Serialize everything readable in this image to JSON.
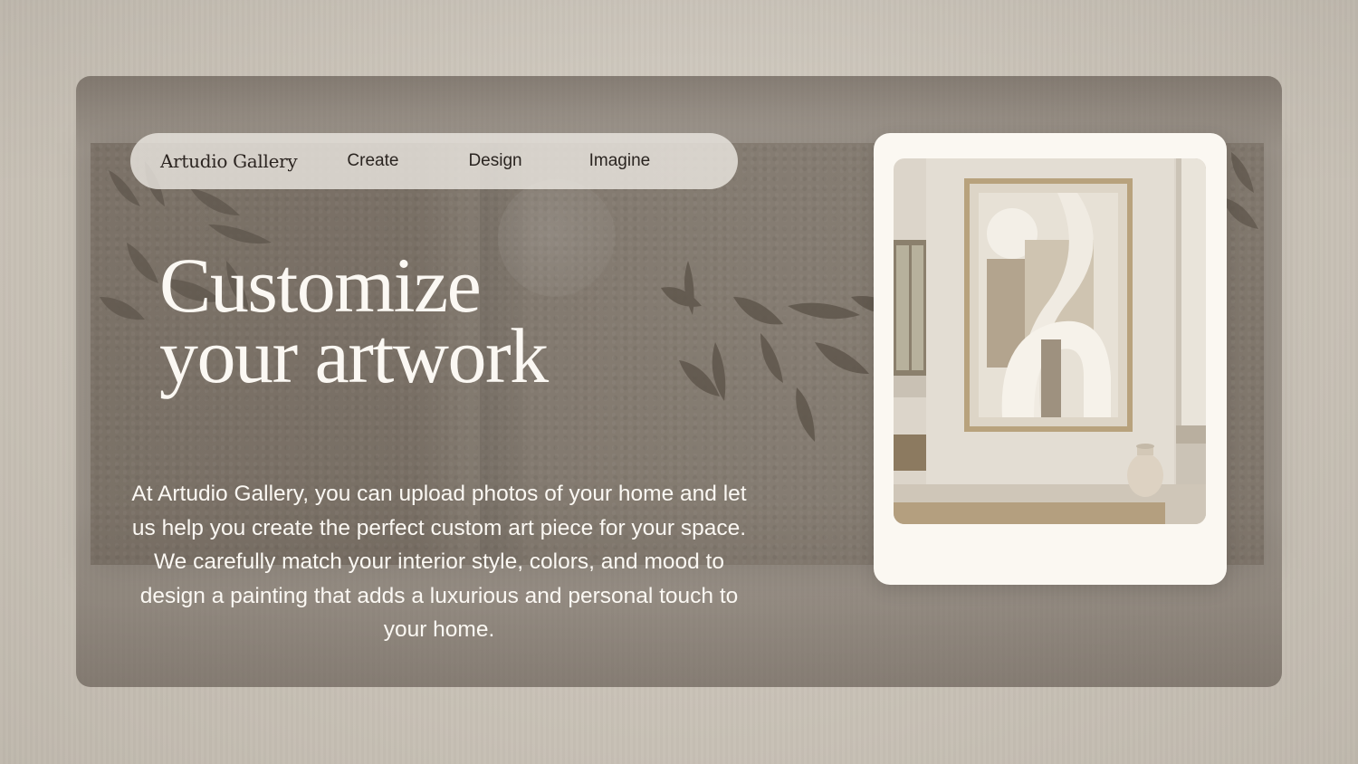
{
  "nav": {
    "brand": "Artudio Gallery",
    "links": [
      {
        "label": "Create"
      },
      {
        "label": "Design"
      },
      {
        "label": "Imagine"
      }
    ]
  },
  "hero": {
    "headline_line1": "Customize",
    "headline_line2": "your artwork",
    "body": "At Artudio Gallery, you can upload photos of your home and let us help you create the perfect custom art piece for your space. We carefully match your interior style, colors, and mood to design a painting that adds a luxurious and personal touch to your home."
  },
  "colors": {
    "page_background": "#cdc6bb",
    "overlay": "#5c524a",
    "nav_pill": "#ece8e2",
    "headline_text": "#fbf8f3",
    "card_background": "#fbf8f2"
  },
  "icons": {
    "decorations": [
      "bamboo-leaves",
      "moon"
    ]
  }
}
